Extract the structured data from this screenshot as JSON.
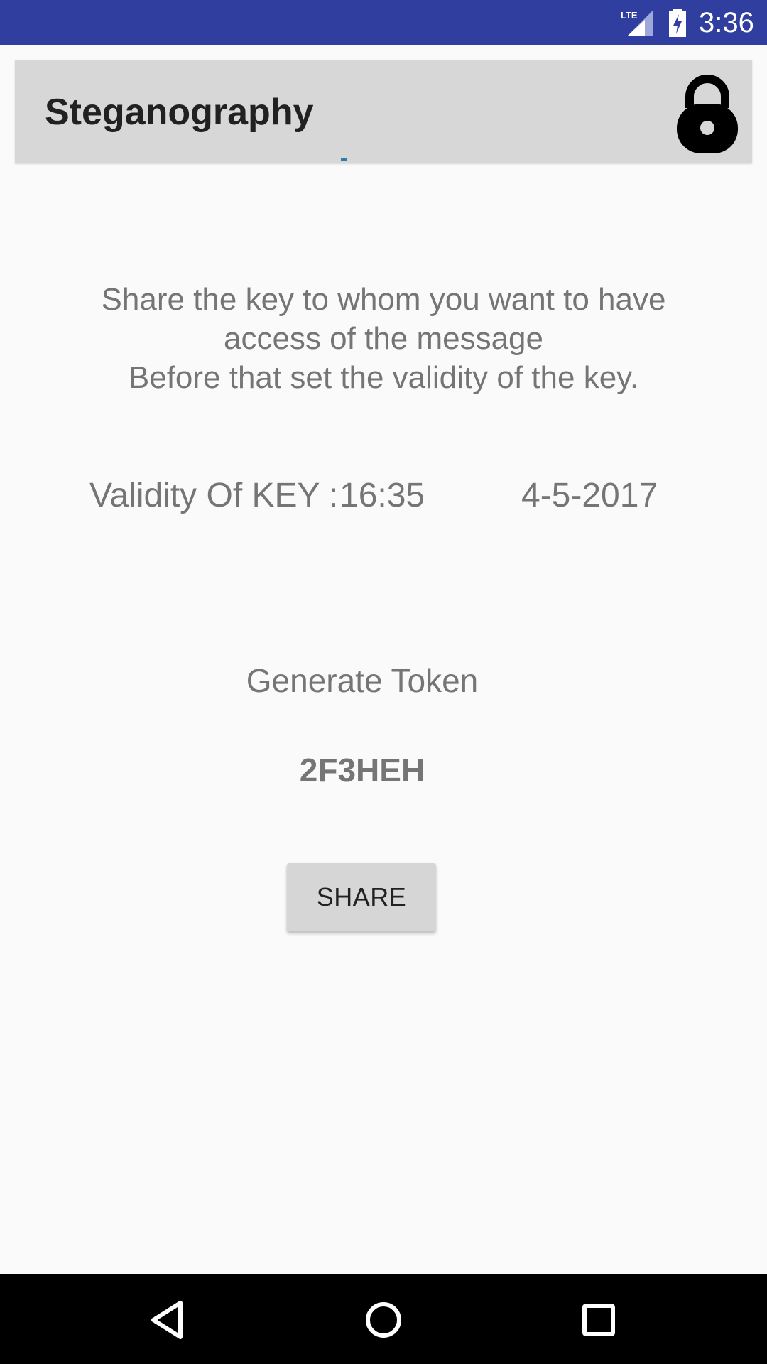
{
  "status_bar": {
    "time": "3:36",
    "network_label": "LTE",
    "network_icon": "lte-signal-icon",
    "battery_icon": "battery-charging-icon",
    "color": "#303f9f"
  },
  "app_bar": {
    "title": "Steganography",
    "lock_icon": "lock-icon",
    "color": "#d7d7d7"
  },
  "main": {
    "instruction_lines": [
      "Share the key to whom you want to have",
      "access of the message",
      "Before that set the validity of the key."
    ],
    "validity_label": "Validity Of KEY :",
    "validity_time": "16:35",
    "validity_date": "4-5-2017",
    "generate_token_label": "Generate Token",
    "token_value": "2F3HEH",
    "share_button_label": "SHARE",
    "text_color": "#757575"
  },
  "nav_bar": {
    "back_icon": "back-triangle-icon",
    "home_icon": "home-circle-icon",
    "recents_icon": "recents-square-icon"
  }
}
